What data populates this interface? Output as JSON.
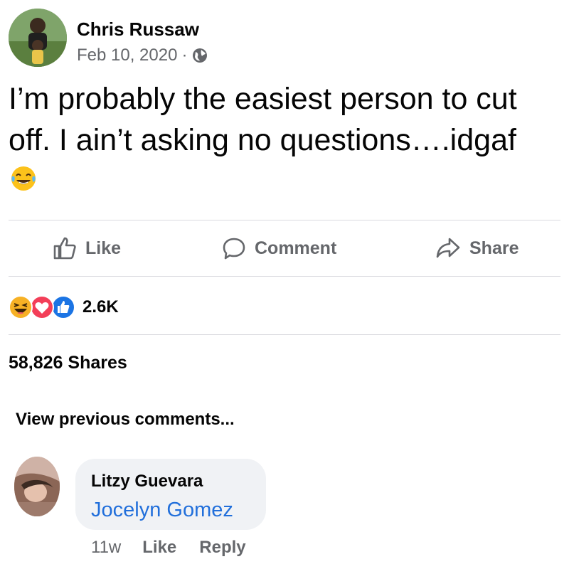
{
  "post": {
    "author": "Chris Russaw",
    "date": "Feb 10, 2020",
    "separator": "·",
    "privacy_icon": "globe-icon",
    "text": "I’m probably the easiest person to cut off. I ain’t asking no questions….idgaf",
    "emoji": "face-with-tears-of-joy"
  },
  "actions": {
    "like": "Like",
    "comment": "Comment",
    "share": "Share"
  },
  "reactions": {
    "icons": [
      "haha-reaction-icon",
      "love-reaction-icon",
      "like-reaction-icon"
    ],
    "count": "2.6K"
  },
  "shares": "58,826 Shares",
  "view_previous": "View previous comments...",
  "comment": {
    "author": "Litzy Guevara",
    "mention": "Jocelyn Gomez",
    "time": "11w",
    "like": "Like",
    "reply": "Reply"
  },
  "colors": {
    "secondary_text": "#65676b",
    "link_blue": "#216fdb",
    "bubble_bg": "#f0f2f5",
    "love_red": "#f33e58",
    "like_blue": "#1b74e4",
    "haha_yellow": "#f7b125"
  }
}
